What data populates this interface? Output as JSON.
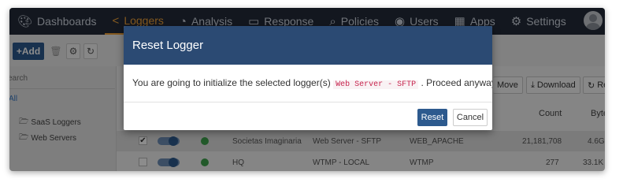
{
  "nav": {
    "items": [
      {
        "label": "Dashboards",
        "icon": "palette-icon"
      },
      {
        "label": "Loggers",
        "icon": "share-icon"
      },
      {
        "label": "Analysis",
        "icon": "pie-chart-icon"
      },
      {
        "label": "Response",
        "icon": "laptop-icon"
      },
      {
        "label": "Policies",
        "icon": "search-icon"
      },
      {
        "label": "Users",
        "icon": "user-circle-icon"
      },
      {
        "label": "Apps",
        "icon": "grid-icon"
      },
      {
        "label": "Settings",
        "icon": "gear-icon"
      }
    ],
    "active": "Loggers",
    "accent_color": "#f0a33a",
    "bar_color": "#232b39"
  },
  "toolbar": {
    "add_label": "Add"
  },
  "sidebar": {
    "search_placeholder": "earch",
    "all_label": "All",
    "items": [
      "SaaS Loggers",
      "Web Servers"
    ]
  },
  "main": {
    "buttons": [
      "Move",
      "Download",
      "Refre"
    ],
    "columns": [
      "Count",
      "Byte"
    ],
    "rows": [
      {
        "name": "Societas Imaginaria",
        "logger": "Web Server - SFTP",
        "type": "WEB_APACHE",
        "count": "21,181,708",
        "bytes": "4.6G",
        "checked": true
      },
      {
        "name": "HQ",
        "logger": "WTMP - LOCAL",
        "type": "WTMP",
        "count": "277",
        "bytes": "33.1K",
        "checked": false
      }
    ]
  },
  "modal": {
    "title": "Reset Logger",
    "message_before": "You are going to initialize the selected logger(s)",
    "logger_code": "Web Server - SFTP",
    "message_after": ". Proceed anyway?",
    "reset_label": "Reset",
    "cancel_label": "Cancel",
    "header_color": "#2b4a73"
  }
}
